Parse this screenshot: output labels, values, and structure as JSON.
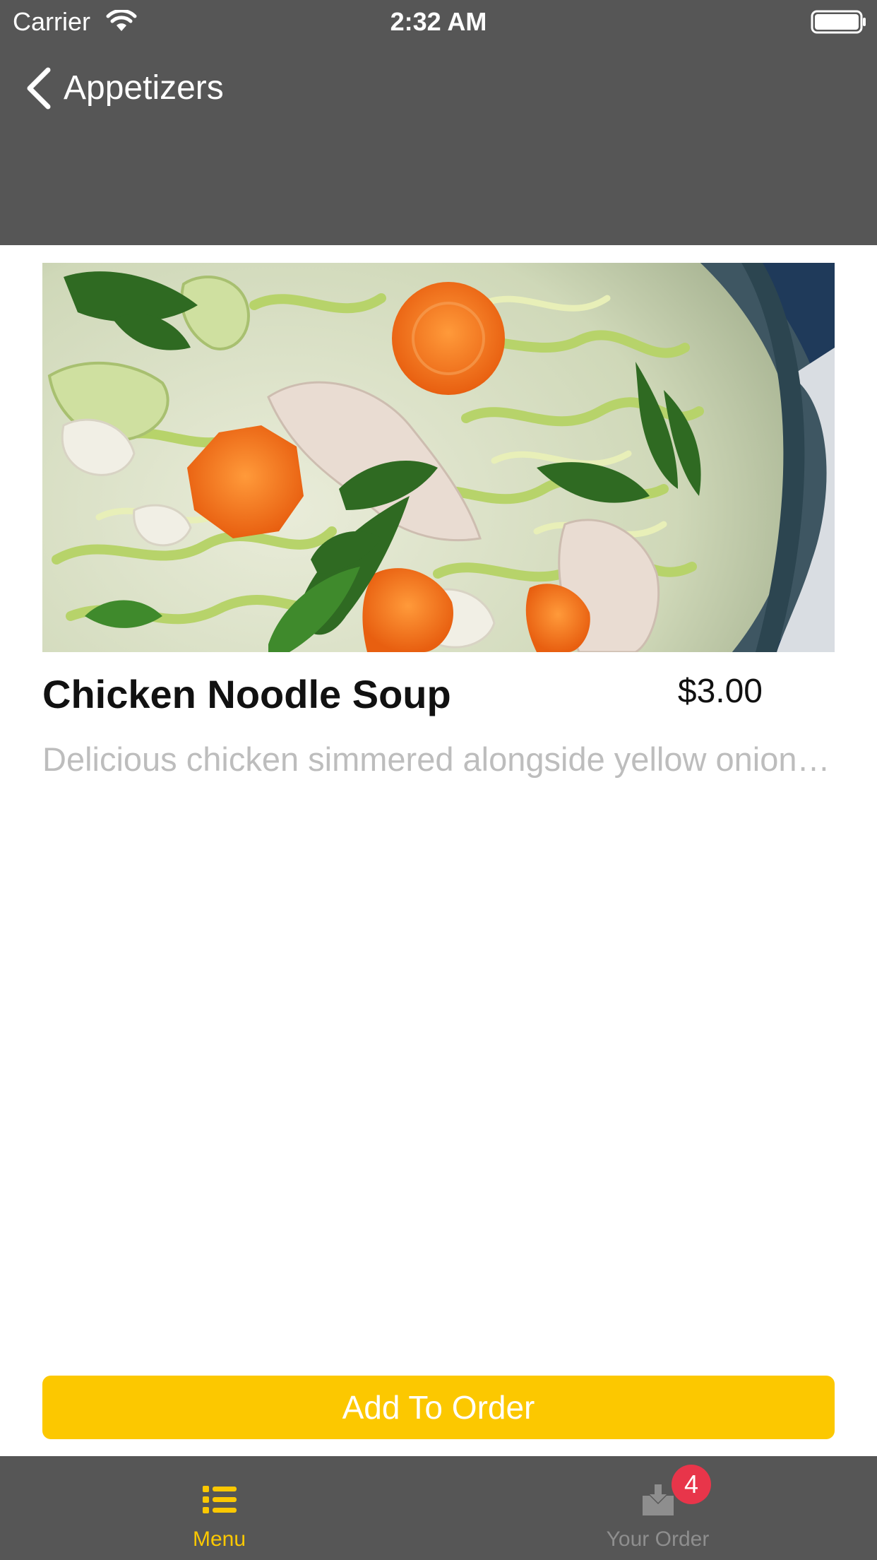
{
  "status_bar": {
    "carrier": "Carrier",
    "time": "2:32 AM"
  },
  "nav": {
    "back_label": "Appetizers",
    "back_icon": "chevron-left-icon"
  },
  "item": {
    "image_alt": "chicken noodle soup photo",
    "title": "Chicken Noodle Soup",
    "price": "$3.00",
    "description": "Delicious chicken simmered alongside yellow onions, celery, carrots and zucchini noodles"
  },
  "actions": {
    "add_to_order": "Add To Order"
  },
  "tabs": [
    {
      "label": "Menu",
      "icon": "list-icon",
      "active": true
    },
    {
      "label": "Your Order",
      "icon": "inbox-download-icon",
      "active": false,
      "badge": "4"
    }
  ],
  "colors": {
    "bar_background": "#565656",
    "accent": "#fcc800",
    "badge": "#e8354a",
    "description_text": "#bdbdbd"
  }
}
